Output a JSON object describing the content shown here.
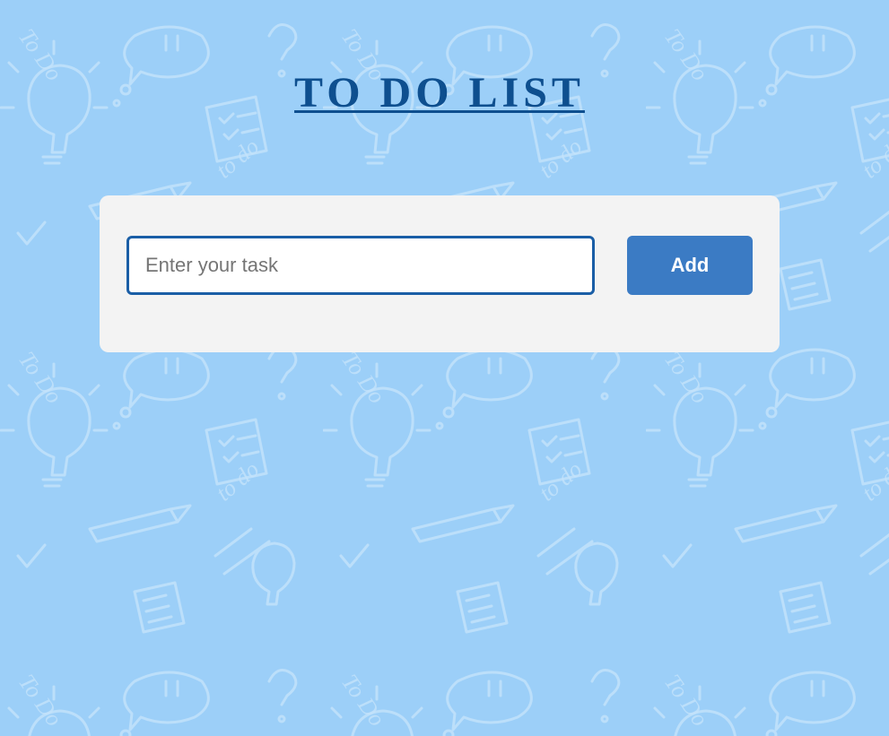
{
  "page": {
    "title": "TO DO LIST"
  },
  "task_form": {
    "input_placeholder": "Enter your task",
    "input_value": "",
    "add_label": "Add"
  },
  "background": {
    "pattern_text": "To Do",
    "pattern_text_alt": "to do"
  },
  "colors": {
    "background": "#9ccff8",
    "title": "#0e4f8f",
    "card": "#f3f3f3",
    "input_border": "#1a5ea6",
    "button": "#3b7bc4"
  }
}
